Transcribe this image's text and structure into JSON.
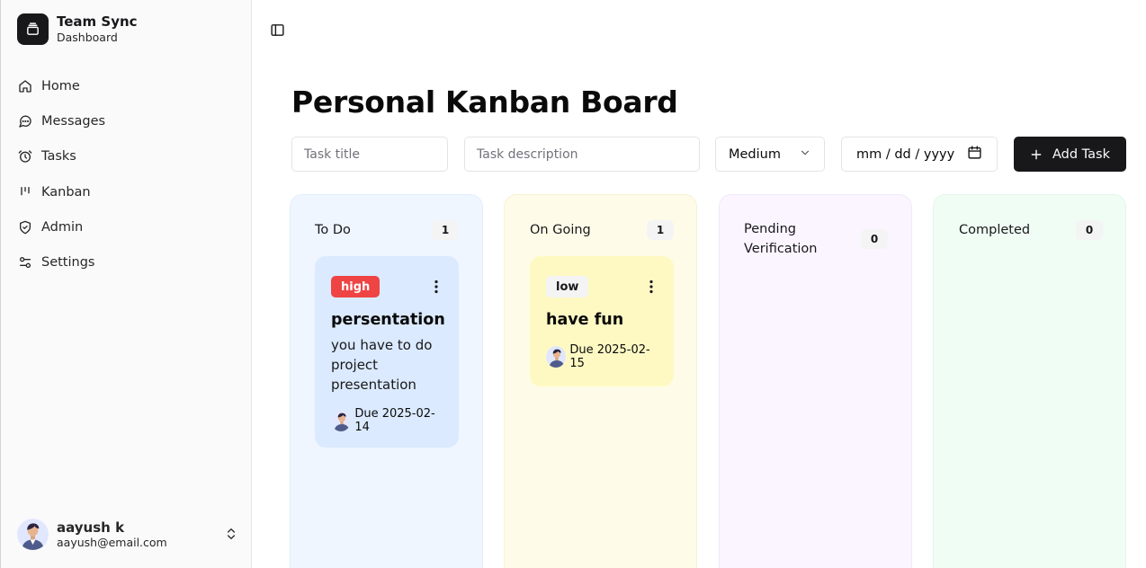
{
  "brand": {
    "title": "Team Sync",
    "subtitle": "Dashboard",
    "icon": "layers-icon"
  },
  "sidebar": {
    "items": [
      {
        "label": "Home",
        "icon": "home-icon"
      },
      {
        "label": "Messages",
        "icon": "message-circle-icon"
      },
      {
        "label": "Tasks",
        "icon": "alarm-clock-icon"
      },
      {
        "label": "Kanban",
        "icon": "kanban-icon"
      },
      {
        "label": "Admin",
        "icon": "shield-check-icon"
      },
      {
        "label": "Settings",
        "icon": "sliders-icon"
      }
    ]
  },
  "user": {
    "name": "aayush k",
    "email": "aayush@email.com"
  },
  "page": {
    "title": "Personal Kanban Board"
  },
  "form": {
    "title_placeholder": "Task title",
    "description_placeholder": "Task description",
    "priority_value": "Medium",
    "date_placeholder": "mm / dd / yyyy",
    "add_label": "Add Task"
  },
  "columns": [
    {
      "title": "To Do",
      "count": "1"
    },
    {
      "title": "On Going",
      "count": "1"
    },
    {
      "title": "Pending Verification",
      "count": "0"
    },
    {
      "title": "Completed",
      "count": "0"
    }
  ],
  "cards": [
    {
      "priority": "high",
      "title": "persentation",
      "description": "you have to do project presentation",
      "due": "Due 2025-02-14"
    },
    {
      "priority": "low",
      "title": "have fun",
      "due": "Due 2025-02-15"
    }
  ],
  "colors": {
    "accent": "#18181b",
    "high": "#ef4444",
    "todo_bg": "#eff6ff",
    "ongoing_bg": "#fefce8",
    "pending_bg": "#faf5ff",
    "completed_bg": "#f0fdf4"
  }
}
